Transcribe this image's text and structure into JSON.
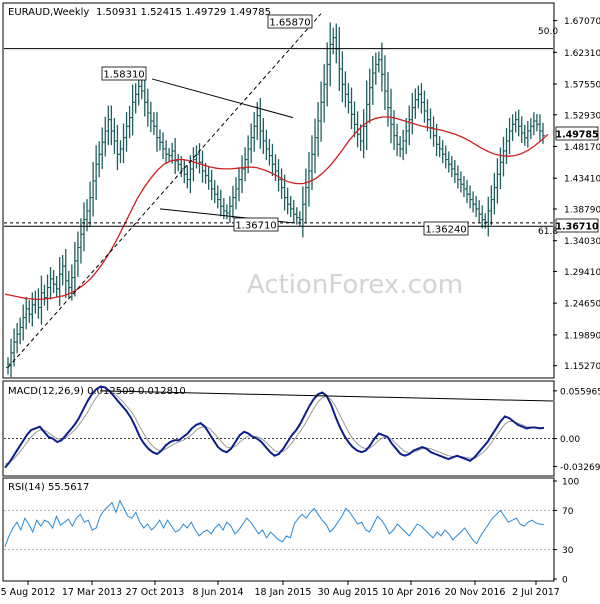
{
  "title": "EURAUD,Weekly",
  "ohlc_text": "1.50931 1.52415 1.49729 1.49785",
  "watermark": "ActionForex.com",
  "colors": {
    "bars": "#1f5f5f",
    "sma": "#d21f1f",
    "macd": "#0b1f8c",
    "signal": "#9a9a9a",
    "rsi": "#2a8ad8",
    "trend": "#000000",
    "axis_text": "#000000",
    "watermark": "#d4d4d4"
  },
  "chart_data": [
    {
      "type": "ohlc",
      "title": "EURAUD,Weekly",
      "ylim": [
        1.1357,
        1.6956
      ],
      "y_ticks": [
        "1.67070",
        "1.62310",
        "1.57550",
        "1.52930",
        "1.48170",
        "1.43410",
        "1.38790",
        "1.34030",
        "1.29410",
        "1.24650",
        "1.19890",
        "1.15270"
      ],
      "x_ticks": [
        "5 Aug 2012",
        "17 Mar 2013",
        "27 Oct 2013",
        "8 Jun 2014",
        "18 Jan 2015",
        "30 Aug 2015",
        "10 Apr 2016",
        "20 Nov 2016",
        "2 Jul 2017"
      ],
      "last_price": "1.49785",
      "callouts": [
        "1.58310",
        "1.65870",
        "1.36710",
        "1.36240"
      ],
      "h_levels": [
        {
          "label": "50.0",
          "value": 1.6287
        },
        {
          "label": "61.8",
          "value": 1.3619
        },
        {
          "label": "1.36710",
          "value": 1.3671
        }
      ],
      "series": [
        {
          "name": "close",
          "values": [
            1.155,
            1.172,
            1.188,
            1.2,
            1.21,
            1.225,
            1.238,
            1.23,
            1.244,
            1.252,
            1.24,
            1.262,
            1.255,
            1.27,
            1.283,
            1.275,
            1.268,
            1.29,
            1.302,
            1.28,
            1.27,
            1.285,
            1.31,
            1.33,
            1.35,
            1.372,
            1.385,
            1.405,
            1.43,
            1.455,
            1.47,
            1.488,
            1.505,
            1.522,
            1.505,
            1.49,
            1.47,
            1.478,
            1.495,
            1.512,
            1.525,
            1.548,
            1.56,
            1.572,
            1.565,
            1.548,
            1.532,
            1.52,
            1.512,
            1.495,
            1.488,
            1.478,
            1.47,
            1.468,
            1.475,
            1.46,
            1.455,
            1.448,
            1.44,
            1.432,
            1.448,
            1.462,
            1.47,
            1.458,
            1.445,
            1.438,
            1.43,
            1.418,
            1.41,
            1.402,
            1.392,
            1.385,
            1.382,
            1.392,
            1.405,
            1.418,
            1.432,
            1.448,
            1.462,
            1.478,
            1.495,
            1.512,
            1.528,
            1.505,
            1.49,
            1.478,
            1.468,
            1.455,
            1.445,
            1.432,
            1.42,
            1.405,
            1.395,
            1.388,
            1.38,
            1.375,
            1.372,
            1.395,
            1.42,
            1.445,
            1.47,
            1.495,
            1.52,
            1.548,
            1.575,
            1.605,
            1.635,
            1.645,
            1.628,
            1.598,
            1.575,
            1.56,
            1.548,
            1.53,
            1.515,
            1.5,
            1.49,
            1.512,
            1.545,
            1.57,
            1.592,
            1.605,
            1.612,
            1.59,
            1.565,
            1.54,
            1.515,
            1.498,
            1.485,
            1.478,
            1.49,
            1.505,
            1.522,
            1.54,
            1.552,
            1.56,
            1.548,
            1.535,
            1.522,
            1.51,
            1.498,
            1.485,
            1.478,
            1.47,
            1.462,
            1.455,
            1.448,
            1.44,
            1.432,
            1.425,
            1.418,
            1.41,
            1.402,
            1.395,
            1.388,
            1.38,
            1.372,
            1.368,
            1.385,
            1.402,
            1.42,
            1.44,
            1.458,
            1.475,
            1.49,
            1.505,
            1.515,
            1.522,
            1.512,
            1.502,
            1.495,
            1.505,
            1.512,
            1.52,
            1.515,
            1.505,
            1.498
          ]
        },
        {
          "name": "SMA",
          "values": [
            1.26,
            1.258,
            1.256,
            1.254,
            1.253,
            1.252,
            1.253,
            1.254,
            1.256,
            1.258,
            1.262,
            1.268,
            1.275,
            1.284,
            1.296,
            1.31,
            1.326,
            1.344,
            1.364,
            1.384,
            1.404,
            1.42,
            1.434,
            1.446,
            1.455,
            1.46,
            1.462,
            1.462,
            1.46,
            1.457,
            1.454,
            1.451,
            1.449,
            1.448,
            1.448,
            1.449,
            1.45,
            1.451,
            1.45,
            1.447,
            1.443,
            1.438,
            1.432,
            1.428,
            1.426,
            1.426,
            1.429,
            1.434,
            1.442,
            1.452,
            1.464,
            1.477,
            1.491,
            1.503,
            1.513,
            1.52,
            1.524,
            1.526,
            1.526,
            1.524,
            1.521,
            1.518,
            1.515,
            1.512,
            1.51,
            1.508,
            1.506,
            1.503,
            1.5,
            1.496,
            1.491,
            1.485,
            1.479,
            1.474,
            1.47,
            1.468,
            1.467,
            1.468,
            1.471,
            1.476,
            1.483,
            1.491,
            1.5
          ]
        }
      ],
      "trendlines": [
        {
          "from": [
            1.5831
          ],
          "to": [
            1.525
          ]
        },
        {
          "from": [
            1.388
          ],
          "to": [
            1.3671
          ]
        }
      ]
    },
    {
      "type": "line",
      "title": "MACD(12,26,9) 0.012509 0.012810",
      "ylim": [
        -0.0415,
        0.064
      ],
      "y_ticks": [
        "0.055965",
        "0.00",
        "-0.03269"
      ],
      "series": [
        {
          "name": "MACD",
          "values": [
            -0.034,
            -0.028,
            -0.02,
            -0.012,
            -0.004,
            0.004,
            0.01,
            0.012,
            0.014,
            0.008,
            0.002,
            0.0,
            -0.004,
            -0.002,
            0.004,
            0.01,
            0.016,
            0.024,
            0.034,
            0.044,
            0.052,
            0.058,
            0.061,
            0.06,
            0.056,
            0.05,
            0.044,
            0.038,
            0.032,
            0.024,
            0.014,
            0.002,
            -0.006,
            -0.012,
            -0.016,
            -0.018,
            -0.014,
            -0.008,
            -0.004,
            -0.002,
            -0.002,
            0.002,
            0.006,
            0.012,
            0.016,
            0.018,
            0.014,
            0.006,
            -0.002,
            -0.01,
            -0.014,
            -0.016,
            -0.012,
            -0.004,
            0.004,
            0.008,
            0.006,
            0.002,
            0.0,
            -0.004,
            -0.01,
            -0.016,
            -0.02,
            -0.018,
            -0.012,
            -0.004,
            0.004,
            0.01,
            0.018,
            0.028,
            0.038,
            0.046,
            0.052,
            0.054,
            0.05,
            0.04,
            0.026,
            0.014,
            0.004,
            -0.004,
            -0.01,
            -0.014,
            -0.016,
            -0.014,
            -0.008,
            0.0,
            0.006,
            0.004,
            0.002,
            -0.006,
            -0.012,
            -0.018,
            -0.02,
            -0.018,
            -0.014,
            -0.012,
            -0.01,
            -0.012,
            -0.016,
            -0.018,
            -0.02,
            -0.022,
            -0.024,
            -0.022,
            -0.02,
            -0.022,
            -0.024,
            -0.026,
            -0.022,
            -0.016,
            -0.01,
            -0.004,
            0.004,
            0.012,
            0.02,
            0.026,
            0.024,
            0.02,
            0.016,
            0.014,
            0.012,
            0.013,
            0.013,
            0.012,
            0.0125
          ]
        },
        {
          "name": "Signal",
          "values": [
            -0.03,
            -0.028,
            -0.024,
            -0.018,
            -0.012,
            -0.005,
            0.002,
            0.007,
            0.01,
            0.01,
            0.007,
            0.003,
            0.0,
            -0.001,
            0.001,
            0.005,
            0.01,
            0.016,
            0.023,
            0.031,
            0.04,
            0.048,
            0.054,
            0.057,
            0.057,
            0.054,
            0.049,
            0.044,
            0.038,
            0.032,
            0.024,
            0.014,
            0.005,
            -0.003,
            -0.009,
            -0.013,
            -0.014,
            -0.012,
            -0.009,
            -0.006,
            -0.004,
            -0.002,
            0.001,
            0.005,
            0.01,
            0.013,
            0.014,
            0.012,
            0.007,
            0.001,
            -0.005,
            -0.01,
            -0.011,
            -0.009,
            -0.004,
            0.0,
            0.003,
            0.003,
            0.002,
            0.0,
            -0.004,
            -0.009,
            -0.014,
            -0.016,
            -0.015,
            -0.011,
            -0.005,
            0.002,
            0.009,
            0.017,
            0.026,
            0.035,
            0.043,
            0.048,
            0.049,
            0.046,
            0.038,
            0.028,
            0.018,
            0.008,
            0.0,
            -0.006,
            -0.01,
            -0.012,
            -0.011,
            -0.007,
            -0.002,
            0.001,
            0.002,
            -0.001,
            -0.006,
            -0.011,
            -0.015,
            -0.017,
            -0.016,
            -0.014,
            -0.012,
            -0.011,
            -0.012,
            -0.014,
            -0.016,
            -0.018,
            -0.02,
            -0.021,
            -0.021,
            -0.021,
            -0.022,
            -0.023,
            -0.023,
            -0.02,
            -0.016,
            -0.011,
            -0.004,
            0.003,
            0.01,
            0.017,
            0.02,
            0.02,
            0.018,
            0.016,
            0.014,
            0.013,
            0.013,
            0.013,
            0.0128
          ]
        }
      ],
      "trendline": {
        "from": 0.056,
        "to": 0.044
      }
    },
    {
      "type": "line",
      "title": "RSI(14) 55.5617",
      "ylim": [
        0,
        100
      ],
      "y_ticks": [
        "100",
        "70",
        "30",
        "0"
      ],
      "h_levels": [
        70,
        30
      ],
      "series": [
        {
          "name": "RSI",
          "values": [
            33,
            44,
            52,
            58,
            50,
            62,
            56,
            48,
            60,
            54,
            60,
            58,
            52,
            64,
            55,
            58,
            61,
            54,
            62,
            66,
            58,
            60,
            50,
            52,
            64,
            70,
            74,
            78,
            68,
            80,
            72,
            64,
            62,
            68,
            58,
            52,
            56,
            50,
            54,
            60,
            52,
            60,
            54,
            48,
            50,
            56,
            52,
            58,
            50,
            44,
            48,
            50,
            46,
            52,
            56,
            50,
            58,
            54,
            46,
            50,
            56,
            62,
            58,
            52,
            46,
            50,
            42,
            48,
            44,
            40,
            38,
            44,
            42,
            56,
            62,
            66,
            62,
            68,
            72,
            66,
            60,
            56,
            48,
            52,
            58,
            64,
            72,
            68,
            62,
            56,
            58,
            50,
            48,
            56,
            64,
            60,
            54,
            46,
            50,
            56,
            52,
            48,
            44,
            50,
            56,
            54,
            50,
            46,
            42,
            48,
            44,
            50,
            46,
            40,
            44,
            48,
            52,
            46,
            40,
            36,
            44,
            50,
            56,
            62,
            66,
            70,
            64,
            58,
            60,
            62,
            56,
            54,
            58,
            60,
            57,
            56,
            55.56
          ]
        }
      ]
    }
  ]
}
